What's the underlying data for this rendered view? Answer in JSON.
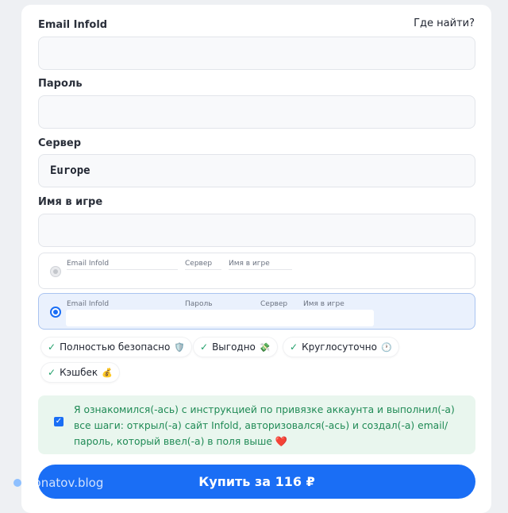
{
  "form": {
    "where_link": "Где найти?",
    "fields": [
      {
        "label": "Email Infold",
        "value": "",
        "placeholder": ""
      },
      {
        "label": "Пароль",
        "value": "",
        "placeholder": ""
      },
      {
        "label": "Сервер",
        "value": "Europe",
        "placeholder": ""
      },
      {
        "label": "Имя в игре",
        "value": "",
        "placeholder": ""
      }
    ]
  },
  "options": {
    "inactive": {
      "col1": "Email Infold",
      "col2": "Сервер",
      "col3": "Имя в игре"
    },
    "active": {
      "col1": "Email Infold",
      "col2": "Пароль",
      "col3": "Сервер",
      "col4": "Имя в игре"
    }
  },
  "badges": [
    {
      "label": "Полностью безопасно",
      "emoji": "🛡️"
    },
    {
      "label": "Выгодно",
      "emoji": "💸"
    },
    {
      "label": "Круглосуточно",
      "emoji": "🕐"
    },
    {
      "label": "Кэшбек",
      "emoji": "💰"
    }
  ],
  "notice": {
    "text": "Я ознакомился(-ась) с инструкцией по привязке аккаунта и выполнил(-а) все шаги: открыл(-а) сайт Infold, авторизовался(-ась) и создал(-а) email/пароль, который ввел(-а) в поля выше ❤️",
    "checked": true
  },
  "buy_button": {
    "label": "Купить за 116 ₽"
  },
  "watermark": {
    "text": "Donatov.blog"
  },
  "colors": {
    "accent": "#1a6ef5",
    "notice_bg": "#e9f6ee",
    "notice_text": "#1f8a55",
    "check": "#22a06b"
  }
}
